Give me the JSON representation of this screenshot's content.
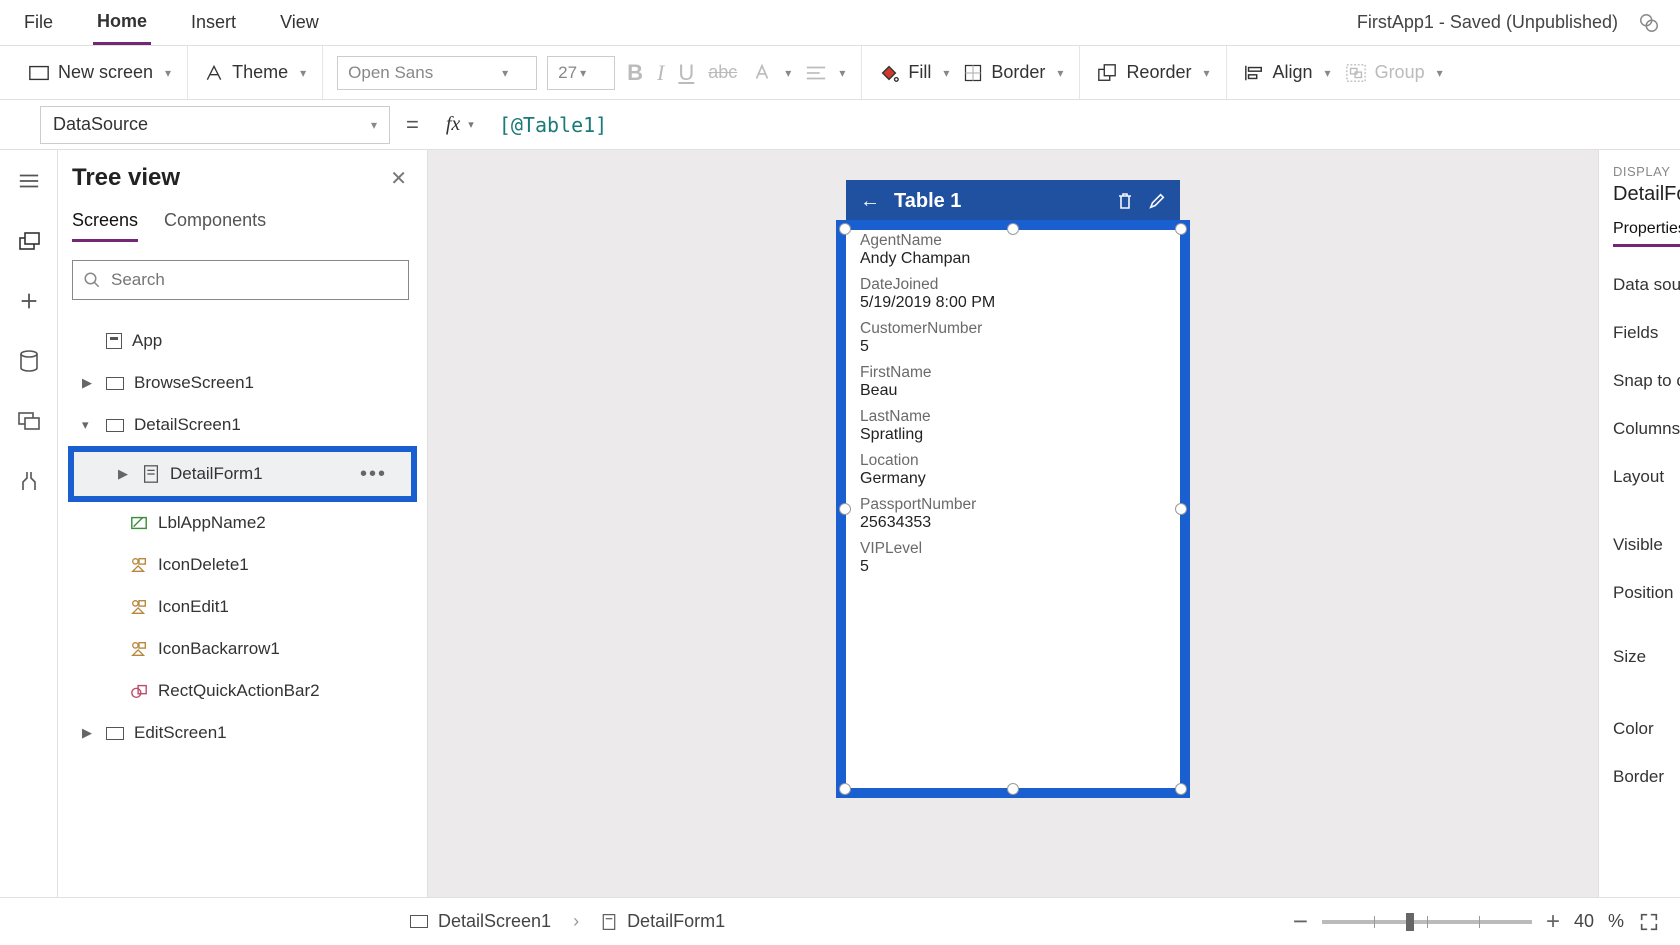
{
  "menu": {
    "file": "File",
    "home": "Home",
    "insert": "Insert",
    "view": "View"
  },
  "app_title": "FirstApp1 - Saved (Unpublished)",
  "ribbon": {
    "new_screen": "New screen",
    "theme": "Theme",
    "font": "Open Sans",
    "font_size": "27",
    "fill": "Fill",
    "border": "Border",
    "reorder": "Reorder",
    "align": "Align",
    "group": "Group"
  },
  "formula": {
    "property": "DataSource",
    "value": "[@Table1]"
  },
  "tree": {
    "title": "Tree view",
    "tabs": {
      "screens": "Screens",
      "components": "Components"
    },
    "search_placeholder": "Search",
    "app": "App",
    "browse": "BrowseScreen1",
    "detail_screen": "DetailScreen1",
    "detail_form": "DetailForm1",
    "lbl_app": "LblAppName2",
    "icon_delete": "IconDelete1",
    "icon_edit": "IconEdit1",
    "icon_back": "IconBackarrow1",
    "rect_quick": "RectQuickActionBar2",
    "edit_screen": "EditScreen1"
  },
  "phone": {
    "title": "Table 1",
    "fields": [
      {
        "label": "AgentName",
        "value": "Andy Champan"
      },
      {
        "label": "DateJoined",
        "value": "5/19/2019 8:00 PM"
      },
      {
        "label": "CustomerNumber",
        "value": "5"
      },
      {
        "label": "FirstName",
        "value": "Beau"
      },
      {
        "label": "LastName",
        "value": "Spratling"
      },
      {
        "label": "Location",
        "value": "Germany"
      },
      {
        "label": "PassportNumber",
        "value": "25634353"
      },
      {
        "label": "VIPLevel",
        "value": "5"
      }
    ]
  },
  "props": {
    "caption": "DISPLAY",
    "name": "DetailForm",
    "tab": "Properties",
    "rows": [
      "Data source",
      "Fields",
      "Snap to col",
      "Columns",
      "Layout",
      "Visible",
      "Position",
      "Size",
      "Color",
      "Border"
    ]
  },
  "status": {
    "crumb1": "DetailScreen1",
    "crumb2": "DetailForm1",
    "zoom": "40",
    "pct": "%"
  }
}
